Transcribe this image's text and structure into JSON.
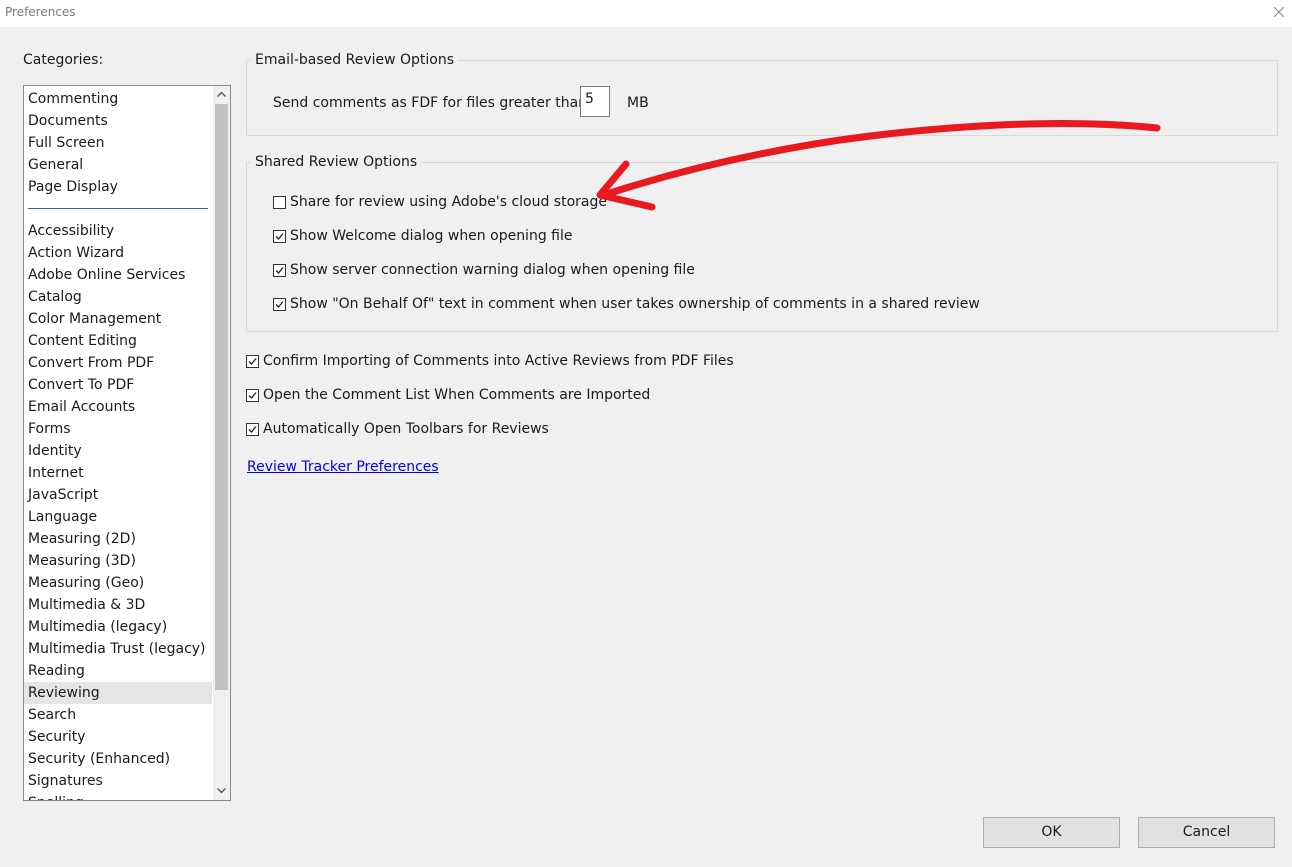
{
  "window": {
    "title": "Preferences"
  },
  "categories": {
    "label": "Categories:",
    "top_items": [
      "Commenting",
      "Documents",
      "Full Screen",
      "General",
      "Page Display"
    ],
    "items": [
      "Accessibility",
      "Action Wizard",
      "Adobe Online Services",
      "Catalog",
      "Color Management",
      "Content Editing",
      "Convert From PDF",
      "Convert To PDF",
      "Email Accounts",
      "Forms",
      "Identity",
      "Internet",
      "JavaScript",
      "Language",
      "Measuring (2D)",
      "Measuring (3D)",
      "Measuring (Geo)",
      "Multimedia & 3D",
      "Multimedia (legacy)",
      "Multimedia Trust (legacy)",
      "Reading",
      "Reviewing",
      "Search",
      "Security",
      "Security (Enhanced)",
      "Signatures",
      "Spelling"
    ],
    "selected": "Reviewing"
  },
  "email_review": {
    "title": "Email-based Review Options",
    "send_label": "Send comments as FDF for files greater than",
    "size_value": "5",
    "unit": "MB"
  },
  "shared_review": {
    "title": "Shared Review Options",
    "options": [
      {
        "label": "Share for review using Adobe's cloud storage",
        "checked": false
      },
      {
        "label": "Show Welcome dialog when opening file",
        "checked": true
      },
      {
        "label": "Show server connection warning dialog when opening file",
        "checked": true
      },
      {
        "label": "Show \"On Behalf Of\" text in comment when user takes ownership of comments in a shared review",
        "checked": true
      }
    ]
  },
  "general_options": [
    {
      "label": "Confirm Importing of Comments into Active Reviews from PDF Files",
      "checked": true
    },
    {
      "label": "Open the Comment List When Comments are Imported",
      "checked": true
    },
    {
      "label": "Automatically Open Toolbars for Reviews",
      "checked": true
    }
  ],
  "link": {
    "label": "Review Tracker Preferences"
  },
  "buttons": {
    "ok": "OK",
    "cancel": "Cancel"
  },
  "colors": {
    "annotation": "#e8191f",
    "link": "#0000ee",
    "selected_row": "#e5e5e5"
  }
}
